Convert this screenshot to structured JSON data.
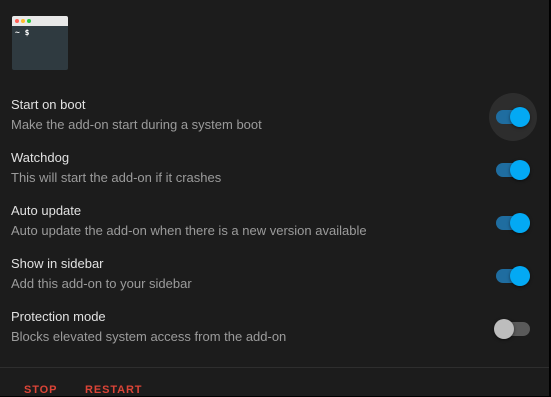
{
  "logo": {
    "prompt": "~ $",
    "dots": [
      "#ff5f56",
      "#ffbd2e",
      "#27c93f"
    ]
  },
  "settings": [
    {
      "title": "Start on boot",
      "description": "Make the add-on start during a system boot",
      "enabled": true
    },
    {
      "title": "Watchdog",
      "description": "This will start the add-on if it crashes",
      "enabled": true
    },
    {
      "title": "Auto update",
      "description": "Auto update the add-on when there is a new version available",
      "enabled": true
    },
    {
      "title": "Show in sidebar",
      "description": "Add this add-on to your sidebar",
      "enabled": true
    },
    {
      "title": "Protection mode",
      "description": "Blocks elevated system access from the add-on",
      "enabled": false
    }
  ],
  "actions": {
    "stop_label": "STOP",
    "restart_label": "RESTART"
  },
  "colors": {
    "accent": "#03a9f4",
    "danger": "#db4437",
    "card_background": "#1c1c1c"
  }
}
